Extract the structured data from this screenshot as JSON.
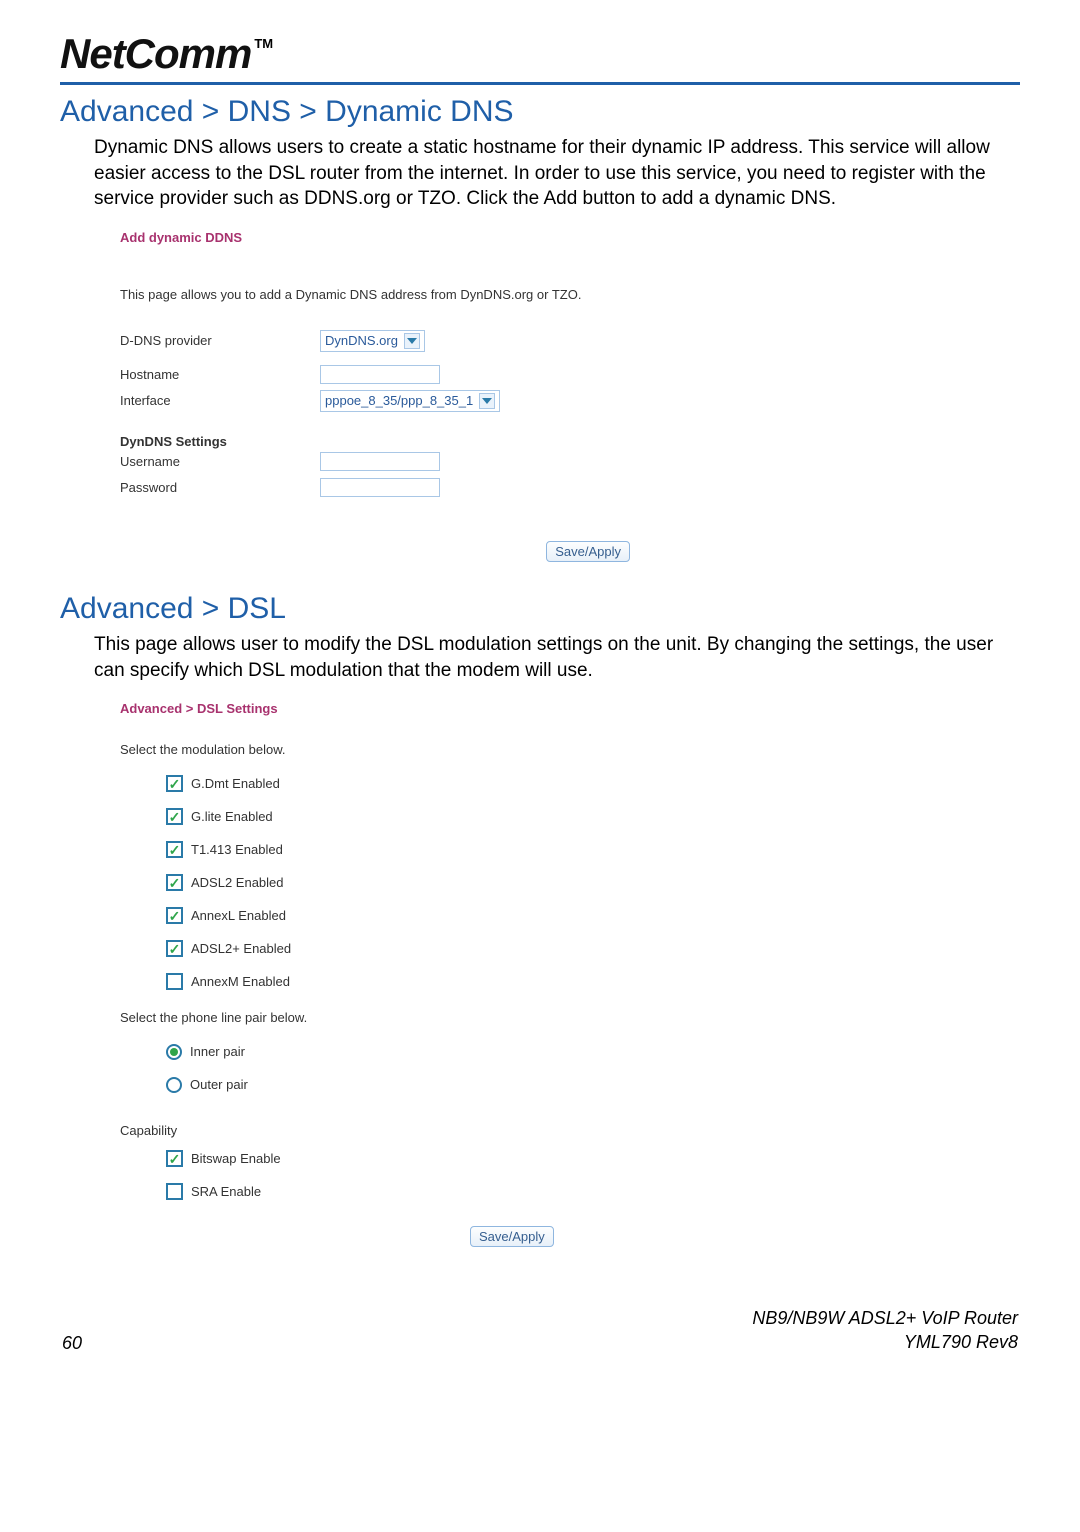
{
  "brand": {
    "name": "NetComm",
    "tm": "TM"
  },
  "section1": {
    "title": "Advanced > DNS > Dynamic DNS",
    "body": "Dynamic DNS allows users to create a static hostname for their dynamic IP address. This service will allow easier access to the DSL router from the internet. In order to use this service, you need to register with the service provider such as DDNS.org or TZO. Click the Add button to add a dynamic DNS.",
    "panel": {
      "heading": "Add dynamic DDNS",
      "desc": "This page allows you to add a Dynamic DNS address from DynDNS.org or TZO.",
      "provider_label": "D-DNS provider",
      "provider_value": "DynDNS.org",
      "hostname_label": "Hostname",
      "hostname_value": "",
      "interface_label": "Interface",
      "interface_value": "pppoe_8_35/ppp_8_35_1",
      "settings_heading": "DynDNS Settings",
      "username_label": "Username",
      "username_value": "",
      "password_label": "Password",
      "password_value": "",
      "save_label": "Save/Apply"
    }
  },
  "section2": {
    "title": "Advanced > DSL",
    "body": "This page allows user to modify the DSL modulation settings on the unit. By changing the settings, the user can specify which DSL modulation that the modem will use.",
    "panel": {
      "heading": "Advanced > DSL Settings",
      "mod_label": "Select the modulation below.",
      "modulations": [
        {
          "label": "G.Dmt Enabled",
          "checked": true
        },
        {
          "label": "G.lite Enabled",
          "checked": true
        },
        {
          "label": "T1.413 Enabled",
          "checked": true
        },
        {
          "label": "ADSL2 Enabled",
          "checked": true
        },
        {
          "label": "AnnexL Enabled",
          "checked": true
        },
        {
          "label": "ADSL2+ Enabled",
          "checked": true
        },
        {
          "label": "AnnexM Enabled",
          "checked": false
        }
      ],
      "pair_label": "Select the phone line pair below.",
      "pairs": [
        {
          "label": "Inner pair",
          "selected": true
        },
        {
          "label": "Outer pair",
          "selected": false
        }
      ],
      "capability_label": "Capability",
      "capabilities": [
        {
          "label": "Bitswap Enable",
          "checked": true
        },
        {
          "label": "SRA Enable",
          "checked": false
        }
      ],
      "save_label": "Save/Apply"
    }
  },
  "footer": {
    "page": "60",
    "model": "NB9/NB9W ADSL2+ VoIP Router",
    "doc": "YML790 Rev8"
  }
}
